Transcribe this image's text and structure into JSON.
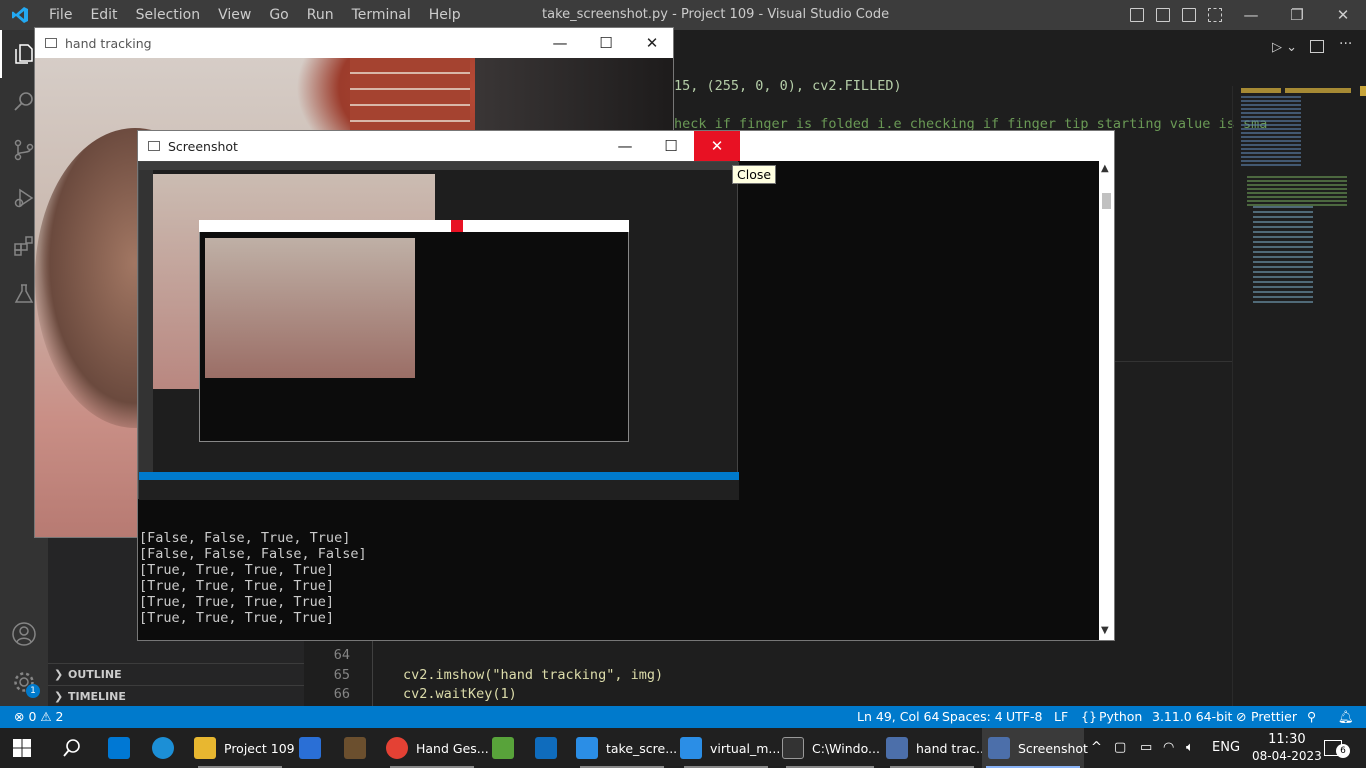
{
  "vscode": {
    "title": "take_screenshot.py - Project 109 - Visual Studio Code",
    "menu": [
      "File",
      "Edit",
      "Selection",
      "View",
      "Go",
      "Run",
      "Terminal",
      "Help"
    ],
    "sidebar": {
      "outline": "OUTLINE",
      "timeline": "TIMELINE"
    },
    "code": [
      {
        "ln": "",
        "text": "15, (255, 0, 0), cv2.FILLED)"
      },
      {
        "ln": "",
        "text": "heck if finger is folded i.e checking if finger tip starting value is sma"
      },
      {
        "ln": "64",
        "text": ""
      },
      {
        "ln": "65",
        "text": "cv2.imshow(\"hand tracking\", img)"
      },
      {
        "ln": "66",
        "text": "cv2.waitKey(1)"
      }
    ],
    "accounts_badge": "1"
  },
  "status": {
    "problems": "⊗ 0 ⚠ 2",
    "position": "Ln 49, Col 64",
    "spaces": "Spaces: 4",
    "encoding": "UTF-8",
    "eol": "LF",
    "language": "Python",
    "interpreter": "3.11.0 64-bit",
    "prettier": "Prettier"
  },
  "hand_window": {
    "title": "hand tracking"
  },
  "screenshot_window": {
    "title": "Screenshot",
    "tooltip": "Close",
    "terminal": [
      "[False, False, True, True]",
      "[False, False, False, False]",
      "[True, True, True, True]",
      "[True, True, True, True]",
      "[True, True, True, True]",
      "[True, True, True, True]"
    ]
  },
  "taskbar": {
    "apps": [
      {
        "label": "Project 109",
        "color": "#e8b730",
        "icon": "folder-icon"
      },
      {
        "label": "Hand Ges...",
        "color": "#e44134",
        "icon": "chrome-icon"
      },
      {
        "label": "take_scre...",
        "color": "#2b8ee6",
        "icon": "vscode-icon"
      },
      {
        "label": "virtual_m...",
        "color": "#2b8ee6",
        "icon": "vscode-icon"
      },
      {
        "label": "C:\\Windo...",
        "color": "#333",
        "icon": "terminal-icon"
      },
      {
        "label": "hand trac...",
        "color": "#4c6faa",
        "icon": "window-icon"
      },
      {
        "label": "Screenshot",
        "color": "#4c6faa",
        "icon": "window-icon"
      }
    ],
    "lang": "ENG",
    "time": "11:30",
    "date": "08-04-2023",
    "notifications": "6"
  }
}
